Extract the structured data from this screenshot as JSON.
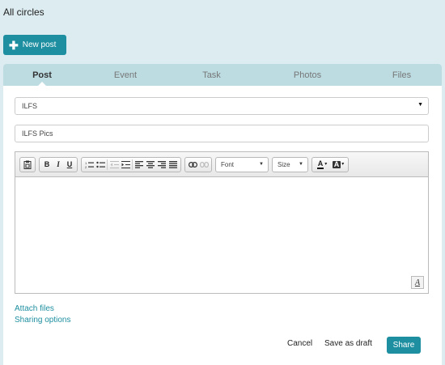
{
  "header": {
    "title": "All circles"
  },
  "new_post": {
    "label": "New post",
    "icon": "plus-icon"
  },
  "tabs": [
    {
      "label": "Post",
      "active": true
    },
    {
      "label": "Event",
      "active": false
    },
    {
      "label": "Task",
      "active": false
    },
    {
      "label": "Photos",
      "active": false
    },
    {
      "label": "Files",
      "active": false
    }
  ],
  "form": {
    "circle_value": "ILFS",
    "title_value": "ILFS Pics"
  },
  "toolbar": {
    "font_label": "Font",
    "size_label": "Size",
    "buttons": [
      "paste-icon",
      "bold-icon",
      "italic-icon",
      "underline-icon",
      "numbered-list-icon",
      "bulleted-list-icon",
      "outdent-icon",
      "indent-icon",
      "align-left-icon",
      "align-center-icon",
      "align-right-icon",
      "justify-icon",
      "link-icon",
      "unlink-icon",
      "text-color-icon",
      "background-color-icon"
    ]
  },
  "links": {
    "attach_files": "Attach files",
    "sharing_options": "Sharing options"
  },
  "actions": {
    "cancel": "Cancel",
    "save_draft": "Save as draft",
    "share": "Share"
  },
  "colors": {
    "accent": "#1e8fa0",
    "background": "#dcecf0",
    "tab_bar": "#bcdce2"
  }
}
